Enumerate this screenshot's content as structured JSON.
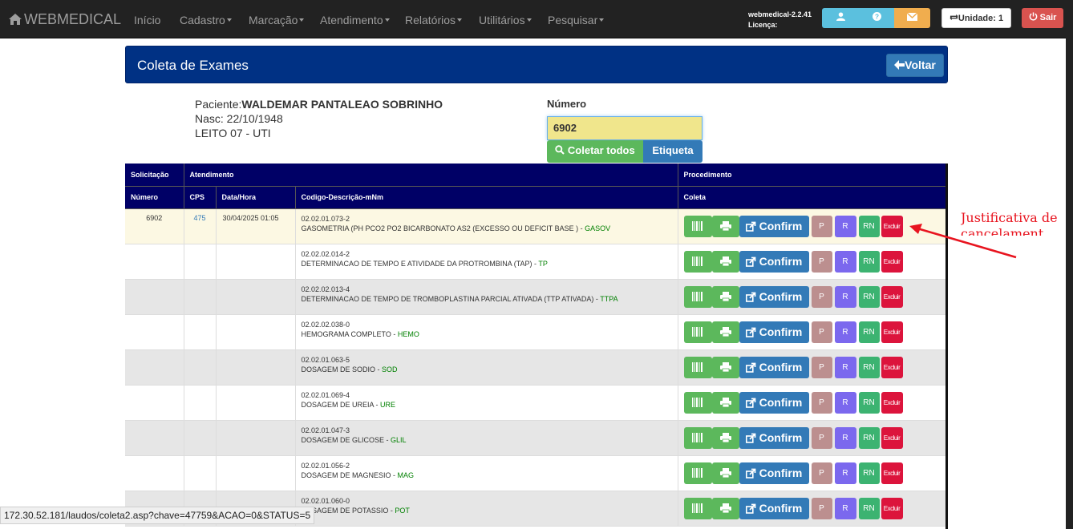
{
  "navbar": {
    "brand": "WEBMEDICAL",
    "items": [
      {
        "label": "Início",
        "dropdown": false
      },
      {
        "label": "Cadastro",
        "dropdown": true
      },
      {
        "label": "Marcação",
        "dropdown": true
      },
      {
        "label": "Atendimento",
        "dropdown": true
      },
      {
        "label": "Relatórios",
        "dropdown": true
      },
      {
        "label": "Utilitários",
        "dropdown": true
      },
      {
        "label": "Pesquisar",
        "dropdown": true
      }
    ],
    "version": "webmedical-2.2.41",
    "license": "Licença:",
    "unidade": "Unidade: 1",
    "sair": "Sair"
  },
  "page": {
    "title": "Coleta de Exames",
    "voltar": "Voltar"
  },
  "patient": {
    "label": "Paciente:",
    "name": "WALDEMAR PANTALEAO SOBRINHO",
    "nasc": "Nasc: 22/10/1948",
    "leito": "LEITO 07 - UTI"
  },
  "numero": {
    "label": "Número",
    "value": "6902",
    "coletar": "Coletar todos",
    "etiqueta": "Etiqueta"
  },
  "table": {
    "group_headers": [
      "Solicitação",
      "Atendimento",
      "Procedimento"
    ],
    "headers": [
      "Número",
      "CPS",
      "Data/Hora",
      "Codigo-Descrição-mNm",
      "Coleta"
    ],
    "actions": {
      "confirm": "Confirm",
      "p": "P",
      "r": "R",
      "rn": "RN",
      "excluir": "Excluir"
    },
    "rows": [
      {
        "numero": "6902",
        "cps": "475",
        "data": "30/04/2025 01:05",
        "codigo": "02.02.01.073-2",
        "descricao": "GASOMETRIA (PH PCO2 PO2 BICARBONATO AS2 (EXCESSO OU DEFICIT BASE ) - ",
        "sigla": "GASOV"
      },
      {
        "numero": "",
        "cps": "",
        "data": "",
        "codigo": "02.02.02.014-2",
        "descricao": "DETERMINACAO DE TEMPO E ATIVIDADE DA PROTROMBINA (TAP) - ",
        "sigla": "TP"
      },
      {
        "numero": "",
        "cps": "",
        "data": "",
        "codigo": "02.02.02.013-4",
        "descricao": "DETERMINACAO DE TEMPO DE TROMBOPLASTINA PARCIAL ATIVADA (TTP ATIVADA) - ",
        "sigla": "TTPA"
      },
      {
        "numero": "",
        "cps": "",
        "data": "",
        "codigo": "02.02.02.038-0",
        "descricao": "HEMOGRAMA COMPLETO - ",
        "sigla": "HEMO"
      },
      {
        "numero": "",
        "cps": "",
        "data": "",
        "codigo": "02.02.01.063-5",
        "descricao": "DOSAGEM DE SODIO - ",
        "sigla": "SOD"
      },
      {
        "numero": "",
        "cps": "",
        "data": "",
        "codigo": "02.02.01.069-4",
        "descricao": "DOSAGEM DE UREIA - ",
        "sigla": "URE"
      },
      {
        "numero": "",
        "cps": "",
        "data": "",
        "codigo": "02.02.01.047-3",
        "descricao": "DOSAGEM DE GLICOSE - ",
        "sigla": "GLIL"
      },
      {
        "numero": "",
        "cps": "",
        "data": "",
        "codigo": "02.02.01.056-2",
        "descricao": "DOSAGEM DE MAGNESIO - ",
        "sigla": "MAG"
      },
      {
        "numero": "",
        "cps": "",
        "data": "",
        "codigo": "02.02.01.060-0",
        "descricao": "DOSAGEM DE POTASSIO - ",
        "sigla": "POT"
      }
    ]
  },
  "annotation": {
    "text": "Justificativa de cancelament",
    "color": "#e8141f"
  },
  "statusbar": {
    "url": "172.30.52.181/laudos/coleta2.asp?chave=47759&ACAO=0&STATUS=5"
  },
  "colors": {
    "navbar": "#222222",
    "title_panel": "#003184",
    "table_header": "#000066",
    "success": "#5cb85c",
    "primary": "#337ab7",
    "danger": "#dc143c"
  }
}
